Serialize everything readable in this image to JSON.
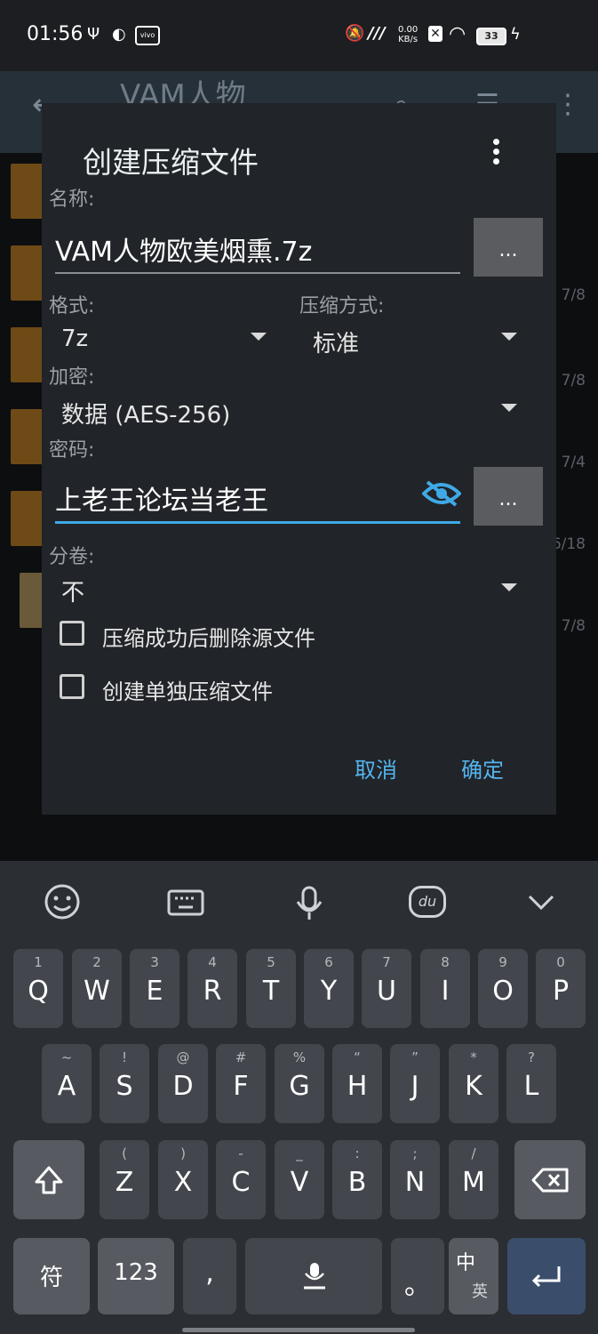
{
  "status_bar": {
    "time": "01:56",
    "net_speed_value": "0.00",
    "net_speed_unit": "KB/s",
    "battery": "33"
  },
  "background_app": {
    "title": "VAM人物",
    "dates": [
      "7/8",
      "7/8",
      "7/4",
      "6/18",
      "7/8"
    ]
  },
  "dialog": {
    "title": "创建压缩文件",
    "name_label": "名称:",
    "name_value": "VAM人物欧美烟熏.7z",
    "browse_label": "...",
    "format_label": "格式:",
    "format_value": "7z",
    "method_label": "压缩方式:",
    "method_value": "标准",
    "encryption_label": "加密:",
    "encryption_value": "数据 (AES-256)",
    "password_label": "密码:",
    "password_value": "上老王论坛当老王",
    "split_label": "分卷:",
    "split_value": "不",
    "delete_source_label": "压缩成功后删除源文件",
    "separate_archive_label": "创建单独压缩文件",
    "cancel_label": "取消",
    "ok_label": "确定"
  },
  "keyboard": {
    "row1": [
      {
        "hint": "1",
        "key": "Q"
      },
      {
        "hint": "2",
        "key": "W"
      },
      {
        "hint": "3",
        "key": "E"
      },
      {
        "hint": "4",
        "key": "R"
      },
      {
        "hint": "5",
        "key": "T"
      },
      {
        "hint": "6",
        "key": "Y"
      },
      {
        "hint": "7",
        "key": "U"
      },
      {
        "hint": "8",
        "key": "I"
      },
      {
        "hint": "9",
        "key": "O"
      },
      {
        "hint": "0",
        "key": "P"
      }
    ],
    "row2": [
      {
        "hint": "~",
        "key": "A"
      },
      {
        "hint": "!",
        "key": "S"
      },
      {
        "hint": "@",
        "key": "D"
      },
      {
        "hint": "#",
        "key": "F"
      },
      {
        "hint": "%",
        "key": "G"
      },
      {
        "hint": "“",
        "key": "H"
      },
      {
        "hint": "”",
        "key": "J"
      },
      {
        "hint": "*",
        "key": "K"
      },
      {
        "hint": "?",
        "key": "L"
      }
    ],
    "row3": [
      {
        "hint": "(",
        "key": "Z"
      },
      {
        "hint": ")",
        "key": "X"
      },
      {
        "hint": "-",
        "key": "C"
      },
      {
        "hint": "_",
        "key": "V"
      },
      {
        "hint": ":",
        "key": "B"
      },
      {
        "hint": ";",
        "key": "N"
      },
      {
        "hint": "/",
        "key": "M"
      }
    ],
    "symbols_label": "符",
    "numbers_label": "123",
    "comma_label": ",",
    "period_label": "。",
    "lang_cn": "中",
    "lang_en": "英",
    "toolbar_icons": [
      "emoji-icon",
      "keyboard-icon",
      "mic-icon",
      "du-icon",
      "chevron-down-icon"
    ],
    "du_label": "du"
  }
}
